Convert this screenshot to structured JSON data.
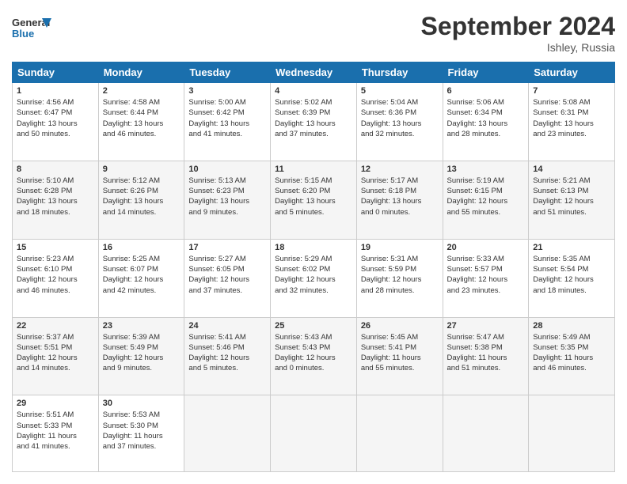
{
  "header": {
    "logo_general": "General",
    "logo_blue": "Blue",
    "month": "September 2024",
    "location": "Ishley, Russia"
  },
  "weekdays": [
    "Sunday",
    "Monday",
    "Tuesday",
    "Wednesday",
    "Thursday",
    "Friday",
    "Saturday"
  ],
  "weeks": [
    [
      {
        "day": "1",
        "info": "Sunrise: 4:56 AM\nSunset: 6:47 PM\nDaylight: 13 hours\nand 50 minutes."
      },
      {
        "day": "2",
        "info": "Sunrise: 4:58 AM\nSunset: 6:44 PM\nDaylight: 13 hours\nand 46 minutes."
      },
      {
        "day": "3",
        "info": "Sunrise: 5:00 AM\nSunset: 6:42 PM\nDaylight: 13 hours\nand 41 minutes."
      },
      {
        "day": "4",
        "info": "Sunrise: 5:02 AM\nSunset: 6:39 PM\nDaylight: 13 hours\nand 37 minutes."
      },
      {
        "day": "5",
        "info": "Sunrise: 5:04 AM\nSunset: 6:36 PM\nDaylight: 13 hours\nand 32 minutes."
      },
      {
        "day": "6",
        "info": "Sunrise: 5:06 AM\nSunset: 6:34 PM\nDaylight: 13 hours\nand 28 minutes."
      },
      {
        "day": "7",
        "info": "Sunrise: 5:08 AM\nSunset: 6:31 PM\nDaylight: 13 hours\nand 23 minutes."
      }
    ],
    [
      {
        "day": "8",
        "info": "Sunrise: 5:10 AM\nSunset: 6:28 PM\nDaylight: 13 hours\nand 18 minutes."
      },
      {
        "day": "9",
        "info": "Sunrise: 5:12 AM\nSunset: 6:26 PM\nDaylight: 13 hours\nand 14 minutes."
      },
      {
        "day": "10",
        "info": "Sunrise: 5:13 AM\nSunset: 6:23 PM\nDaylight: 13 hours\nand 9 minutes."
      },
      {
        "day": "11",
        "info": "Sunrise: 5:15 AM\nSunset: 6:20 PM\nDaylight: 13 hours\nand 5 minutes."
      },
      {
        "day": "12",
        "info": "Sunrise: 5:17 AM\nSunset: 6:18 PM\nDaylight: 13 hours\nand 0 minutes."
      },
      {
        "day": "13",
        "info": "Sunrise: 5:19 AM\nSunset: 6:15 PM\nDaylight: 12 hours\nand 55 minutes."
      },
      {
        "day": "14",
        "info": "Sunrise: 5:21 AM\nSunset: 6:13 PM\nDaylight: 12 hours\nand 51 minutes."
      }
    ],
    [
      {
        "day": "15",
        "info": "Sunrise: 5:23 AM\nSunset: 6:10 PM\nDaylight: 12 hours\nand 46 minutes."
      },
      {
        "day": "16",
        "info": "Sunrise: 5:25 AM\nSunset: 6:07 PM\nDaylight: 12 hours\nand 42 minutes."
      },
      {
        "day": "17",
        "info": "Sunrise: 5:27 AM\nSunset: 6:05 PM\nDaylight: 12 hours\nand 37 minutes."
      },
      {
        "day": "18",
        "info": "Sunrise: 5:29 AM\nSunset: 6:02 PM\nDaylight: 12 hours\nand 32 minutes."
      },
      {
        "day": "19",
        "info": "Sunrise: 5:31 AM\nSunset: 5:59 PM\nDaylight: 12 hours\nand 28 minutes."
      },
      {
        "day": "20",
        "info": "Sunrise: 5:33 AM\nSunset: 5:57 PM\nDaylight: 12 hours\nand 23 minutes."
      },
      {
        "day": "21",
        "info": "Sunrise: 5:35 AM\nSunset: 5:54 PM\nDaylight: 12 hours\nand 18 minutes."
      }
    ],
    [
      {
        "day": "22",
        "info": "Sunrise: 5:37 AM\nSunset: 5:51 PM\nDaylight: 12 hours\nand 14 minutes."
      },
      {
        "day": "23",
        "info": "Sunrise: 5:39 AM\nSunset: 5:49 PM\nDaylight: 12 hours\nand 9 minutes."
      },
      {
        "day": "24",
        "info": "Sunrise: 5:41 AM\nSunset: 5:46 PM\nDaylight: 12 hours\nand 5 minutes."
      },
      {
        "day": "25",
        "info": "Sunrise: 5:43 AM\nSunset: 5:43 PM\nDaylight: 12 hours\nand 0 minutes."
      },
      {
        "day": "26",
        "info": "Sunrise: 5:45 AM\nSunset: 5:41 PM\nDaylight: 11 hours\nand 55 minutes."
      },
      {
        "day": "27",
        "info": "Sunrise: 5:47 AM\nSunset: 5:38 PM\nDaylight: 11 hours\nand 51 minutes."
      },
      {
        "day": "28",
        "info": "Sunrise: 5:49 AM\nSunset: 5:35 PM\nDaylight: 11 hours\nand 46 minutes."
      }
    ],
    [
      {
        "day": "29",
        "info": "Sunrise: 5:51 AM\nSunset: 5:33 PM\nDaylight: 11 hours\nand 41 minutes."
      },
      {
        "day": "30",
        "info": "Sunrise: 5:53 AM\nSunset: 5:30 PM\nDaylight: 11 hours\nand 37 minutes."
      },
      {
        "day": "",
        "info": ""
      },
      {
        "day": "",
        "info": ""
      },
      {
        "day": "",
        "info": ""
      },
      {
        "day": "",
        "info": ""
      },
      {
        "day": "",
        "info": ""
      }
    ]
  ]
}
